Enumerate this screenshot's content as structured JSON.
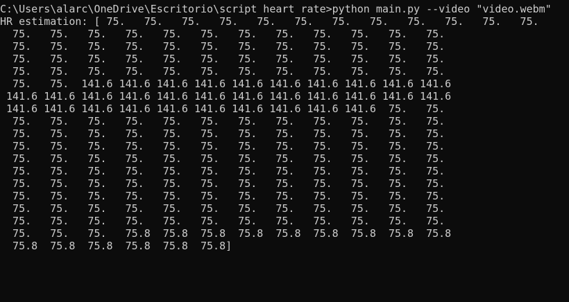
{
  "console": {
    "lines": [
      "C:\\Users\\alarc\\OneDrive\\Escritorio\\script heart rate>python main.py --video \"video.webm\"",
      "HR estimation: [ 75.   75.   75.   75.   75.   75.   75.   75.   75.   75.   75.   75.",
      "  75.   75.   75.   75.   75.   75.   75.   75.   75.   75.   75.   75.",
      "  75.   75.   75.   75.   75.   75.   75.   75.   75.   75.   75.   75.",
      "  75.   75.   75.   75.   75.   75.   75.   75.   75.   75.   75.   75.",
      "  75.   75.   75.   75.   75.   75.   75.   75.   75.   75.   75.   75.",
      "  75.   75.  141.6 141.6 141.6 141.6 141.6 141.6 141.6 141.6 141.6 141.6",
      " 141.6 141.6 141.6 141.6 141.6 141.6 141.6 141.6 141.6 141.6 141.6 141.6",
      " 141.6 141.6 141.6 141.6 141.6 141.6 141.6 141.6 141.6 141.6  75.   75.",
      "  75.   75.   75.   75.   75.   75.   75.   75.   75.   75.   75.   75.",
      "  75.   75.   75.   75.   75.   75.   75.   75.   75.   75.   75.   75.",
      "  75.   75.   75.   75.   75.   75.   75.   75.   75.   75.   75.   75.",
      "  75.   75.   75.   75.   75.   75.   75.   75.   75.   75.   75.   75.",
      "  75.   75.   75.   75.   75.   75.   75.   75.   75.   75.   75.   75.",
      "  75.   75.   75.   75.   75.   75.   75.   75.   75.   75.   75.   75.",
      "  75.   75.   75.   75.   75.   75.   75.   75.   75.   75.   75.   75.",
      "  75.   75.   75.   75.   75.   75.   75.   75.   75.   75.   75.   75.",
      "  75.   75.   75.   75.   75.   75.   75.   75.   75.   75.   75.   75.",
      "  75.   75.   75.   75.8  75.8  75.8  75.8  75.8  75.8  75.8  75.8  75.8",
      "  75.8  75.8  75.8  75.8  75.8  75.8]"
    ]
  }
}
